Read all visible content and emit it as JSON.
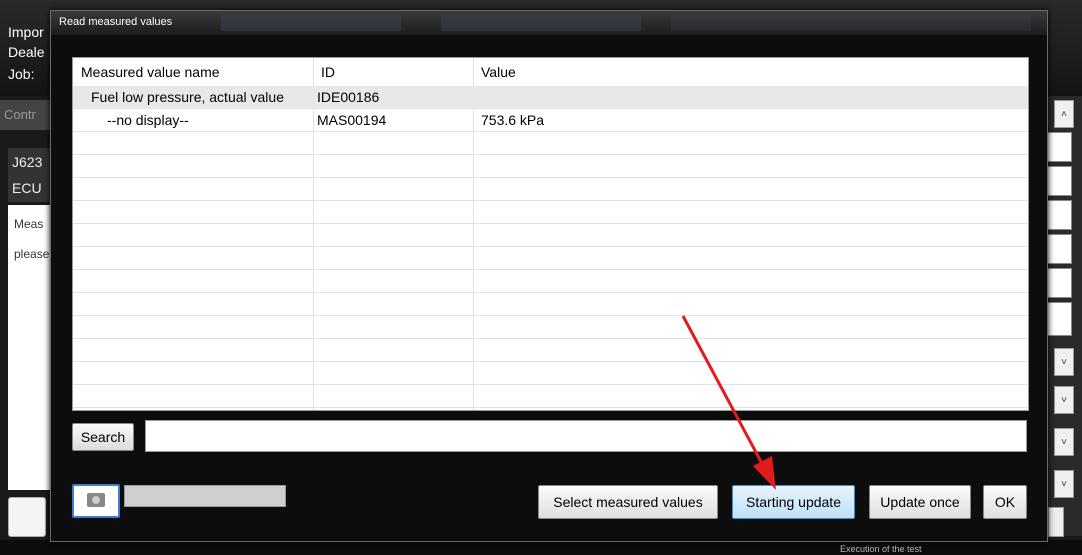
{
  "background": {
    "header_labels": [
      "Impor",
      "Deale",
      "Job:"
    ],
    "left_tab": "Contr",
    "left_rows": [
      "J623",
      "ECU"
    ],
    "left_panel_text": [
      "Meas",
      "please"
    ],
    "bottom_text": "Execution of the test"
  },
  "dialog": {
    "title": "Read measured values"
  },
  "table": {
    "columns": [
      "Measured value name",
      "ID",
      "Value"
    ],
    "rows": [
      {
        "name": "Fuel low pressure, actual value",
        "id": "IDE00186",
        "value": ""
      },
      {
        "name": "--no display--",
        "id": "MAS00194",
        "value": "753.6 kPa"
      }
    ]
  },
  "search": {
    "button_label": "Search",
    "value": ""
  },
  "buttons": {
    "select": "Select measured values",
    "start": "Starting update",
    "update_once": "Update once",
    "ok": "OK"
  },
  "colors": {
    "accent": "#3b7dd8",
    "annotation_arrow": "#e11b1b"
  },
  "icons": {
    "camera": "camera-icon",
    "annotation": "red-arrow-annotation"
  }
}
